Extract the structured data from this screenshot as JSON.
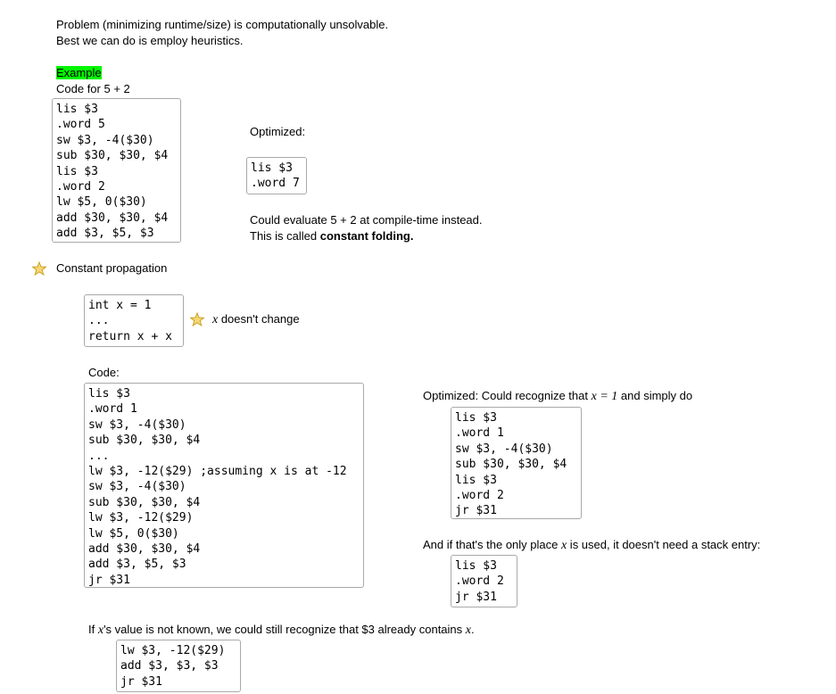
{
  "intro": {
    "line1": "Problem (minimizing runtime/size) is computationally unsolvable.",
    "line2": "Best we can do is employ heuristics."
  },
  "example": {
    "heading": "Example",
    "caption": "Code for 5 + 2",
    "code": "lis $3\n.word 5\nsw $3, -4($30)\nsub $30, $30, $4\nlis $3\n.word 2\nlw $5, 0($30)\nadd $30, $30, $4\nadd $3, $5, $3",
    "optimized_label": "Optimized:",
    "optimized_code": "lis $3\n.word 7",
    "note_line1": "Could evaluate 5 + 2 at compile-time instead.",
    "note_line2_prefix": "This is called ",
    "note_line2_bold": "constant folding."
  },
  "constant_propagation": {
    "heading": "Constant propagation",
    "snippet": "int x = 1\n...\nreturn x + x",
    "remark_var": "x",
    "remark_text": " doesn't change",
    "code_label": "Code:",
    "code": "lis $3\n.word 1\nsw $3, -4($30)\nsub $30, $30, $4\n...\nlw $3, -12($29) ;assuming x is at -12\nsw $3, -4($30)\nsub $30, $30, $4\nlw $3, -12($29)\nlw $5, 0($30)\nadd $30, $30, $4\nadd $3, $5, $3\njr $31",
    "optimized_prefix": "Optimized: Could recognize that ",
    "optimized_math": "x = 1",
    "optimized_suffix": " and simply do",
    "optimized_code": "lis $3\n.word 1\nsw $3, -4($30)\nsub $30, $30, $4\nlis $3\n.word 2\njr $31",
    "only_place_prefix": "And if that's the only place ",
    "only_place_var": "x",
    "only_place_suffix": " is used, it doesn't need a stack entry:",
    "only_place_code": "lis $3\n.word 2\njr $31",
    "unknown_prefix": "If ",
    "unknown_var": "x",
    "unknown_mid": "'s value is not known, we could still recognize that $3 already contains ",
    "unknown_var2": "x",
    "unknown_end": ".",
    "unknown_code": "lw $3, -12($29)\nadd $3, $3, $3\njr $31"
  },
  "colors": {
    "highlight": "#00f700",
    "star_fill": "#f7d774",
    "star_stroke": "#c9a227",
    "box_border": "#a9a9a9"
  },
  "icons": {
    "bullet_star": "star-icon",
    "remark_star": "star-icon"
  }
}
